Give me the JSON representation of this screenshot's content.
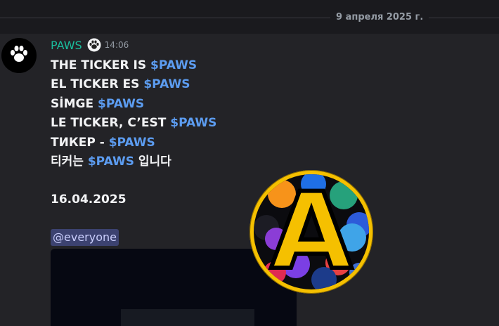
{
  "date_divider": {
    "label": "9 апреля 2025 г."
  },
  "message": {
    "username": "PAWS",
    "timestamp": "14:06",
    "lines": [
      {
        "text": "THE TICKER IS ",
        "cashtag": "$PAWS",
        "suffix": ""
      },
      {
        "text": "EL TICKER ES ",
        "cashtag": "$PAWS",
        "suffix": ""
      },
      {
        "text": "SİMGE ",
        "cashtag": "$PAWS",
        "suffix": ""
      },
      {
        "text": "LE TICKER, C’EST ",
        "cashtag": "$PAWS",
        "suffix": ""
      },
      {
        "text": "ТИКЕР - ",
        "cashtag": "$PAWS",
        "suffix": ""
      },
      {
        "text": "티커는 ",
        "cashtag": "$PAWS",
        "suffix": " 입니다"
      }
    ],
    "date_text": "16.04.2025",
    "mention": "@everyone"
  },
  "overlay_logo": {
    "letter": "A"
  },
  "icons": {
    "avatar": "paw-icon",
    "badge": "paw-badge-icon"
  },
  "colors": {
    "username": "#1abc9c",
    "cashtag": "#5c9cf0",
    "mention_bg": "#3c4270",
    "logo_ring": "#f5c000"
  }
}
